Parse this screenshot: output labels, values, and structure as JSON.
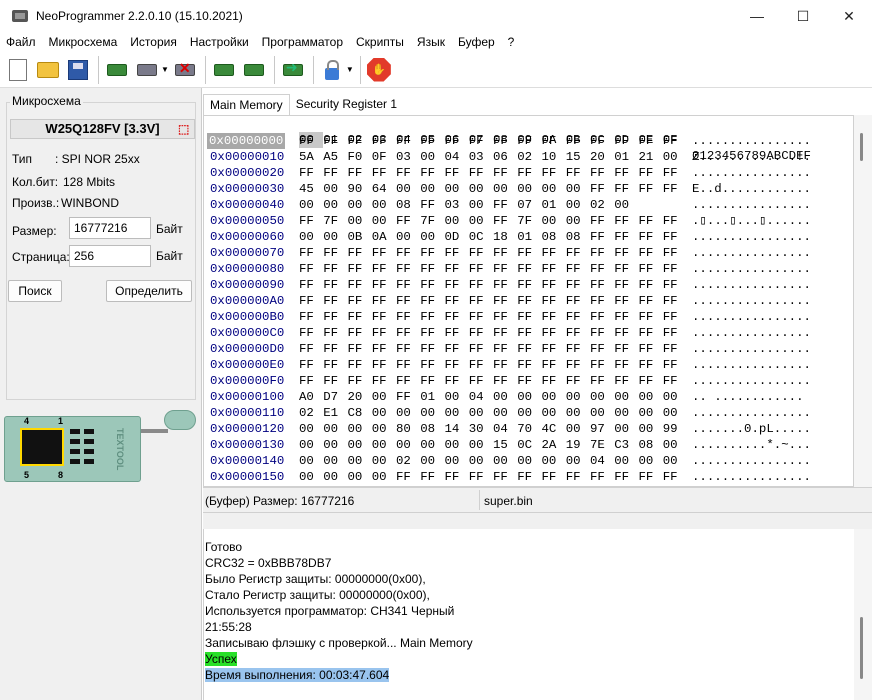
{
  "window": {
    "title": "NeoProgrammer 2.2.0.10 (15.10.2021)"
  },
  "menu": [
    "Файл",
    "Микросхема",
    "История",
    "Настройки",
    "Программатор",
    "Скрипты",
    "Язык",
    "Буфер",
    "?"
  ],
  "toolbar_icons": [
    "new-file-icon",
    "open-folder-icon",
    "save-icon",
    "read-chip-icon",
    "verify-chip-icon",
    "erase-chip-icon",
    "write-chip-icon",
    "blank-check-icon",
    "auto-program-icon",
    "protect-lock-icon",
    "stop-icon"
  ],
  "chip": {
    "group_title": "Микросхема",
    "name": "W25Q128FV [3.3V]",
    "type_label": "Тип",
    "type_value": ": SPI NOR 25xx",
    "bits_label": "Кол.бит:",
    "bits_value": "128 Mbits",
    "maker_label": "Произв.:",
    "maker_value": "WINBOND",
    "size_label": "Размер:",
    "size_value": "16777216",
    "size_unit": "Байт",
    "page_label": "Страница:",
    "page_value": "256",
    "page_unit": "Байт",
    "search_button": "Поиск",
    "detect_button": "Определить"
  },
  "socket": {
    "pin1": "4",
    "pin2": "1",
    "pin3": "5",
    "pin4": "8",
    "label": "TEXTOOL"
  },
  "tabs": [
    "Main Memory",
    "Security Register 1"
  ],
  "hex": {
    "header": [
      "00",
      "01",
      "02",
      "03",
      "04",
      "05",
      "06",
      "07",
      "08",
      "09",
      "0A",
      "0B",
      "0C",
      "0D",
      "0E",
      "0F"
    ],
    "ascii_header": "0123456789ABCDEF",
    "rows": [
      {
        "addr": "0x00000000",
        "bytes": "FF FF FF FF FF FF FF FF FF FF FF FF FF FF FF FF",
        "ascii": "................"
      },
      {
        "addr": "0x00000010",
        "bytes": "5A A5 F0 0F 03 00 04 03 06 02 10 15 20 01 21 00",
        "ascii": "Z........... .!."
      },
      {
        "addr": "0x00000020",
        "bytes": "FF FF FF FF FF FF FF FF FF FF FF FF FF FF FF FF",
        "ascii": "................"
      },
      {
        "addr": "0x00000030",
        "bytes": "45 00 90 64 00 00 00 00 00 00 00 00 FF FF FF FF",
        "ascii": "E..d............"
      },
      {
        "addr": "0x00000040",
        "bytes": "00 00 00 00 08 FF 03 00 FF 07 01 00 02 00",
        "ascii": "................"
      },
      {
        "addr": "0x00000050",
        "bytes": "FF 7F 00 00 FF 7F 00 00 FF 7F 00 00 FF FF FF FF",
        "ascii": ".▯...▯...▯......"
      },
      {
        "addr": "0x00000060",
        "bytes": "00 00 0B 0A 00 00 0D 0C 18 01 08 08 FF FF FF FF",
        "ascii": "................"
      },
      {
        "addr": "0x00000070",
        "bytes": "FF FF FF FF FF FF FF FF FF FF FF FF FF FF FF FF",
        "ascii": "................"
      },
      {
        "addr": "0x00000080",
        "bytes": "FF FF FF FF FF FF FF FF FF FF FF FF FF FF FF FF",
        "ascii": "................"
      },
      {
        "addr": "0x00000090",
        "bytes": "FF FF FF FF FF FF FF FF FF FF FF FF FF FF FF FF",
        "ascii": "................"
      },
      {
        "addr": "0x000000A0",
        "bytes": "FF FF FF FF FF FF FF FF FF FF FF FF FF FF FF FF",
        "ascii": "................"
      },
      {
        "addr": "0x000000B0",
        "bytes": "FF FF FF FF FF FF FF FF FF FF FF FF FF FF FF FF",
        "ascii": "................"
      },
      {
        "addr": "0x000000C0",
        "bytes": "FF FF FF FF FF FF FF FF FF FF FF FF FF FF FF FF",
        "ascii": "................"
      },
      {
        "addr": "0x000000D0",
        "bytes": "FF FF FF FF FF FF FF FF FF FF FF FF FF FF FF FF",
        "ascii": "................"
      },
      {
        "addr": "0x000000E0",
        "bytes": "FF FF FF FF FF FF FF FF FF FF FF FF FF FF FF FF",
        "ascii": "................"
      },
      {
        "addr": "0x000000F0",
        "bytes": "FF FF FF FF FF FF FF FF FF FF FF FF FF FF FF FF",
        "ascii": "................"
      },
      {
        "addr": "0x00000100",
        "bytes": "A0 D7 20 00 FF 01 00 04 00 00 00 00 00 00 00 00",
        "ascii": ".. ............"
      },
      {
        "addr": "0x00000110",
        "bytes": "02 E1 C8 00 00 00 00 00 00 00 00 00 00 00 00 00",
        "ascii": "................"
      },
      {
        "addr": "0x00000120",
        "bytes": "00 00 00 00 80 08 14 30 04 70 4C 00 97 00 00 99",
        "ascii": ".......0.pL....."
      },
      {
        "addr": "0x00000130",
        "bytes": "00 00 00 00 00 00 00 00 15 0C 2A 19 7E C3 08 00",
        "ascii": "..........*.~..."
      },
      {
        "addr": "0x00000140",
        "bytes": "00 00 00 00 02 00 00 00 00 00 00 00 04 00 00 00",
        "ascii": "................"
      },
      {
        "addr": "0x00000150",
        "bytes": "00 00 00 00 FF FF FF FF FF FF FF FF FF FF FF FF",
        "ascii": "................"
      }
    ]
  },
  "status": {
    "buffer_size": "(Буфер) Размер: 16777216",
    "file": "super.bin"
  },
  "log": [
    "Готово",
    "CRC32 = 0xBBB78DB7",
    "Было Регистр защиты: 00000000(0x00),",
    "Стало Регистр защиты: 00000000(0x00),",
    "Используется программатор: CH341 Черный",
    "21:55:28",
    "Записываю флэшку с проверкой... Main Memory",
    "Успех",
    "Время выполнения: 00:03:47.604"
  ],
  "colors": {
    "success_highlight": "#28e028",
    "selection_highlight": "#99c4ee",
    "address_color": "#000080"
  }
}
